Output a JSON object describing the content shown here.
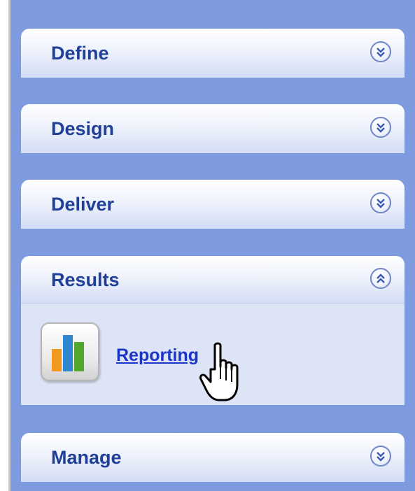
{
  "sections": [
    {
      "label": "Define",
      "state": "collapsed",
      "chevron_icon": "double-chevron-down-icon"
    },
    {
      "label": "Design",
      "state": "collapsed",
      "chevron_icon": "double-chevron-down-icon"
    },
    {
      "label": "Deliver",
      "state": "collapsed",
      "chevron_icon": "double-chevron-down-icon"
    },
    {
      "label": "Results",
      "state": "expanded",
      "chevron_icon": "double-chevron-up-icon",
      "items": [
        {
          "label": "Reporting",
          "icon": "bar-chart-icon"
        }
      ]
    },
    {
      "label": "Manage",
      "state": "collapsed",
      "chevron_icon": "double-chevron-down-icon"
    }
  ],
  "colors": {
    "panel_background": "#7f9bdf",
    "header_text": "#1f3f99",
    "link_text": "#1a35c8",
    "expanded_body": "#dce4f6"
  },
  "cursor": "hand-pointer-icon"
}
